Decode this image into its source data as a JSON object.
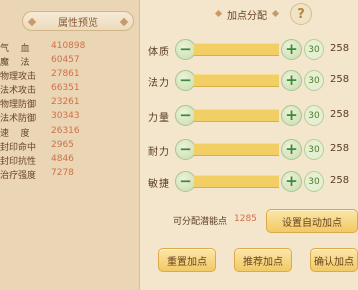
{
  "stats": {
    "header": "属性预览",
    "rows": [
      {
        "name": "气    血",
        "value": "410898"
      },
      {
        "name": "魔    法",
        "value": "60457"
      },
      {
        "name": "物理攻击",
        "value": "27861"
      },
      {
        "name": "法术攻击",
        "value": "66351"
      },
      {
        "name": "物理防御",
        "value": "23261"
      },
      {
        "name": "法术防御",
        "value": "30343"
      },
      {
        "name": "速    度",
        "value": "26316"
      },
      {
        "name": "封印命中",
        "value": "2965"
      },
      {
        "name": "封印抗性",
        "value": "4846"
      },
      {
        "name": "治疗强度",
        "value": "7278"
      }
    ]
  },
  "alloc": {
    "header": "加点分配",
    "help": "?",
    "minus": "−",
    "plus": "+",
    "attributes": [
      {
        "label": "体质",
        "step": "30",
        "value": "258"
      },
      {
        "label": "法力",
        "step": "30",
        "value": "258"
      },
      {
        "label": "力量",
        "step": "30",
        "value": "258"
      },
      {
        "label": "耐力",
        "step": "30",
        "value": "258"
      },
      {
        "label": "敏捷",
        "step": "30",
        "value": "258"
      }
    ],
    "points_label": "可分配潜能点",
    "points_value": "1285",
    "auto_button": "设置自动加点",
    "reset_button": "重置加点",
    "recommend_button": "推荐加点",
    "confirm_button": "确认加点"
  },
  "colors": {
    "stat_value": "#d0704a",
    "bar_fill": "#f2cf64",
    "plus_minus": "#3d8a38",
    "button_bg": "#f2c965"
  }
}
